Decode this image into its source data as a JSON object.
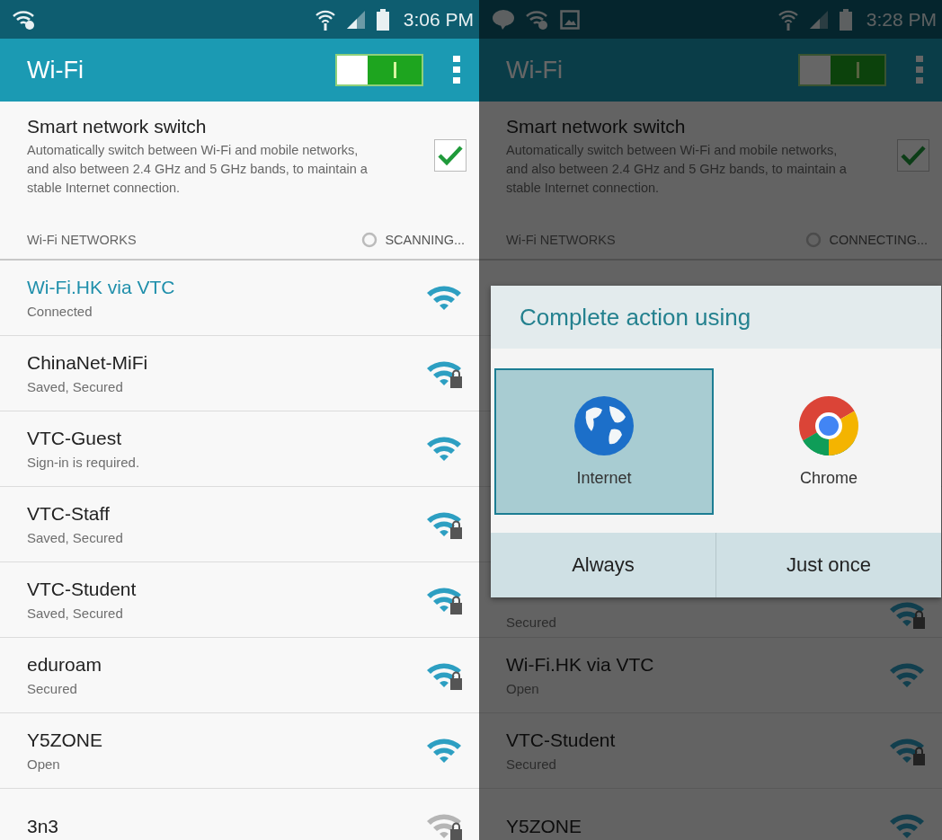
{
  "screens": [
    {
      "status_bar": {
        "notifications": [
          {
            "kind": "wifi-question"
          }
        ],
        "time": "3:06 PM"
      },
      "app_bar": {
        "title": "Wi-Fi",
        "switch_on": true
      },
      "smart_switch": {
        "title": "Smart network switch",
        "description": "Automatically switch between Wi-Fi and mobile networks, and also between 2.4 GHz and 5 GHz bands, to maintain a stable Internet connection.",
        "checked": true
      },
      "section": {
        "title": "Wi-Fi NETWORKS",
        "status": "SCANNING..."
      },
      "networks": [
        {
          "name": "Wi-Fi.HK via VTC",
          "subtitle": "Connected",
          "connected": true,
          "lock": false,
          "faded": false
        },
        {
          "name": "ChinaNet-MiFi",
          "subtitle": "Saved, Secured",
          "connected": false,
          "lock": true,
          "faded": false
        },
        {
          "name": "VTC-Guest",
          "subtitle": "Sign-in is required.",
          "connected": false,
          "lock": false,
          "faded": false
        },
        {
          "name": "VTC-Staff",
          "subtitle": "Saved, Secured",
          "connected": false,
          "lock": true,
          "faded": false
        },
        {
          "name": "VTC-Student",
          "subtitle": "Saved, Secured",
          "connected": false,
          "lock": true,
          "faded": false
        },
        {
          "name": "eduroam",
          "subtitle": "Secured",
          "connected": false,
          "lock": true,
          "faded": false
        },
        {
          "name": "Y5ZONE",
          "subtitle": "Open",
          "connected": false,
          "lock": false,
          "faded": false
        },
        {
          "name": "3n3",
          "connected": false,
          "lock": true,
          "faded": true
        }
      ]
    },
    {
      "status_bar": {
        "notifications": [
          {
            "kind": "chat"
          },
          {
            "kind": "wifi-question"
          },
          {
            "kind": "image"
          }
        ],
        "time": "3:28 PM"
      },
      "app_bar": {
        "title": "Wi-Fi",
        "switch_on": true
      },
      "smart_switch": {
        "title": "Smart network switch",
        "description": "Automatically switch between Wi-Fi and mobile networks, and also between 2.4 GHz and 5 GHz bands, to maintain a stable Internet connection.",
        "checked": true
      },
      "section": {
        "title": "Wi-Fi NETWORKS",
        "status": "CONNECTING..."
      },
      "networks": [
        {
          "subtitle": "Secured",
          "connected": false,
          "lock": true,
          "faded": false
        },
        {
          "name": "Wi-Fi.HK via VTC",
          "subtitle": "Open",
          "connected": false,
          "lock": false,
          "faded": false
        },
        {
          "name": "VTC-Student",
          "subtitle": "Secured",
          "connected": false,
          "lock": true,
          "faded": false
        },
        {
          "name": "Y5ZONE",
          "connected": false,
          "lock": false,
          "faded": false
        }
      ],
      "dialog": {
        "title": "Complete action using",
        "options": [
          {
            "label": "Internet",
            "kind": "globe",
            "selected": true
          },
          {
            "label": "Chrome",
            "kind": "chrome",
            "selected": false
          }
        ],
        "buttons": [
          "Always",
          "Just once"
        ]
      }
    }
  ]
}
